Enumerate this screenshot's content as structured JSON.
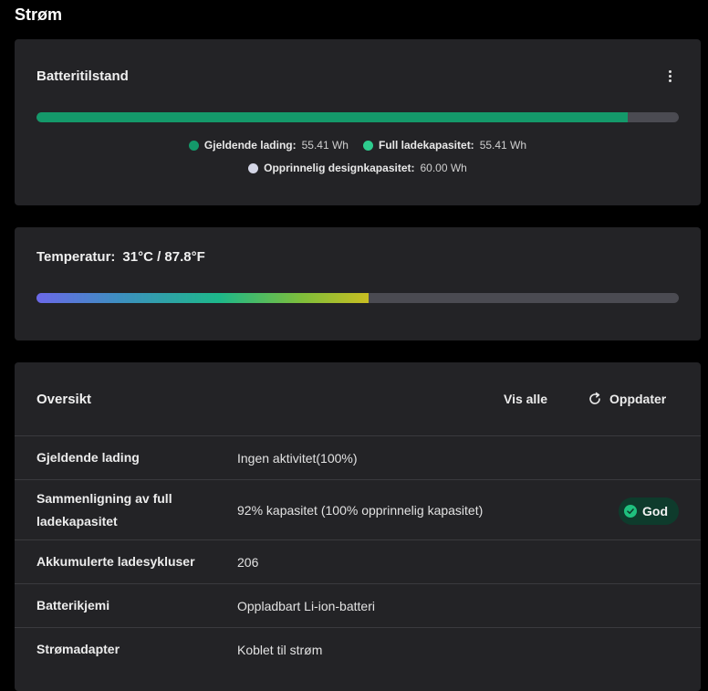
{
  "page": {
    "title": "Strøm"
  },
  "battery": {
    "title": "Batteritilstand",
    "charge_fraction": 0.92,
    "fill_color": "#14996a",
    "legend": [
      {
        "label": "Gjeldende lading:",
        "value": "55.41 Wh",
        "color": "#14996a"
      },
      {
        "label": "Full ladekapasitet:",
        "value": "55.41 Wh",
        "color": "#2ecc8e"
      },
      {
        "label": "Opprinnelig designkapasitet:",
        "value": "60.00 Wh",
        "color": "#d4d6e6"
      }
    ]
  },
  "temperature": {
    "label": "Temperatur:",
    "value": "31°C / 87.8°F",
    "level_fraction": 0.517
  },
  "overview": {
    "title": "Oversikt",
    "view_all_label": "Vis alle",
    "refresh_label": "Oppdater",
    "rows": [
      {
        "label": "Gjeldende lading",
        "value": "Ingen aktivitet(100%)"
      },
      {
        "label": "Sammenligning av full ladekapasitet",
        "value": "92% kapasitet (100% opprinnelig kapasitet)",
        "badge": "God"
      },
      {
        "label": "Akkumulerte ladesykluser",
        "value": "206"
      },
      {
        "label": "Batterikjemi",
        "value": "Oppladbart Li-ion-batteri"
      },
      {
        "label": "Strømadapter",
        "value": "Koblet til strøm"
      }
    ]
  }
}
